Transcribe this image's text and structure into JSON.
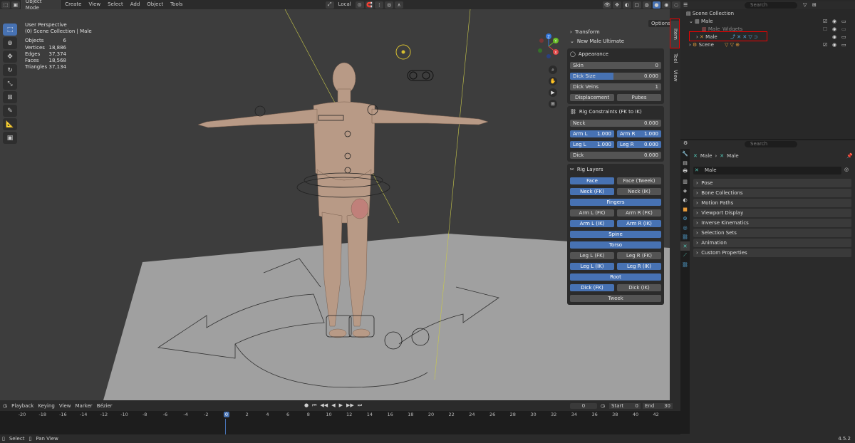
{
  "topbar": {
    "mode": "Object Mode",
    "menus": [
      "Create",
      "View",
      "Select",
      "Add",
      "Object",
      "Tools"
    ],
    "transform_orientation": "Local"
  },
  "viewport": {
    "view_name": "User Perspective",
    "collection_path": "(0) Scene Collection | Male",
    "options_label": "Options",
    "stats": [
      {
        "label": "Objects",
        "value": "6"
      },
      {
        "label": "Vertices",
        "value": "18,886"
      },
      {
        "label": "Edges",
        "value": "37,374"
      },
      {
        "label": "Faces",
        "value": "18,568"
      },
      {
        "label": "Triangles",
        "value": "37,134"
      }
    ],
    "gizmo": {
      "x": "X",
      "y": "Y",
      "z": "Z"
    }
  },
  "npanel": {
    "transform": "Transform",
    "addon": "New Male Ultimate",
    "appearance": {
      "title": "Appearance",
      "skin_label": "Skin",
      "skin_value": "0",
      "dick_size_label": "Dick Size",
      "dick_size_value": "0.000",
      "dick_size_fill": 0.48,
      "dick_veins_label": "Dick Veins",
      "dick_veins_value": "1",
      "displacement": "Displacement",
      "pubes": "Pubes"
    },
    "rig_constraints": {
      "title": "Rig Constraints (FK to IK)",
      "neck_label": "Neck",
      "neck_value": "0.000",
      "arm_l": "Arm L",
      "arm_l_val": "1.000",
      "arm_r": "Arm R",
      "arm_r_val": "1.000",
      "leg_l": "Leg L",
      "leg_l_val": "1.000",
      "leg_r": "Leg R",
      "leg_r_val": "0.000",
      "dick": "Dick",
      "dick_val": "0.000"
    },
    "rig_layers": {
      "title": "Rig Layers",
      "face": "Face",
      "face_tweek": "Face (Tweek)",
      "neck_fk": "Neck (FK)",
      "neck_ik": "Neck (IK)",
      "fingers": "Fingers",
      "arm_l_fk": "Arm L (FK)",
      "arm_r_fk": "Arm R (FK)",
      "arm_l_ik": "Arm L (IK)",
      "arm_r_ik": "Arm R (IK)",
      "spine": "Spine",
      "torso": "Torso",
      "leg_l_fk": "Leg L (FK)",
      "leg_r_fk": "Leg R (FK)",
      "leg_l_ik": "Leg L (IK)",
      "leg_r_ik": "Leg R (IK)",
      "root": "Root",
      "dick_fk": "Dick (FK)",
      "dick_ik": "Dick (IK)",
      "tweek": "Tweek"
    },
    "tabs": [
      "Item",
      "Tool",
      "View"
    ]
  },
  "outliner": {
    "search_placeholder": "Search",
    "scene_collection": "Scene Collection",
    "male_collection": "Male",
    "male_widgets": "Male_Widgets",
    "male_object": "Male",
    "scene": "Scene"
  },
  "properties": {
    "search_placeholder": "Search",
    "breadcrumb_a": "Male",
    "breadcrumb_b": "Male",
    "object_name": "Male",
    "sections": [
      "Pose",
      "Bone Collections",
      "Motion Paths",
      "Viewport Display",
      "Inverse Kinematics",
      "Selection Sets",
      "Animation",
      "Custom Properties"
    ]
  },
  "timeline": {
    "playback": "Playback",
    "keying": "Keying",
    "view": "View",
    "marker": "Marker",
    "interp": "Bézier",
    "current_frame": "0",
    "start_label": "Start",
    "start": "0",
    "end_label": "End",
    "end": "30",
    "ruler": [
      "-20",
      "-18",
      "-16",
      "-14",
      "-12",
      "-10",
      "-8",
      "-6",
      "-4",
      "-2",
      "0",
      "2",
      "4",
      "6",
      "8",
      "10",
      "12",
      "14",
      "16",
      "18",
      "20",
      "22",
      "24",
      "26",
      "28",
      "30",
      "32",
      "34",
      "36",
      "38",
      "40",
      "42"
    ]
  },
  "statusbar": {
    "select": "Select",
    "pan": "Pan View",
    "version": "4.5.2"
  }
}
